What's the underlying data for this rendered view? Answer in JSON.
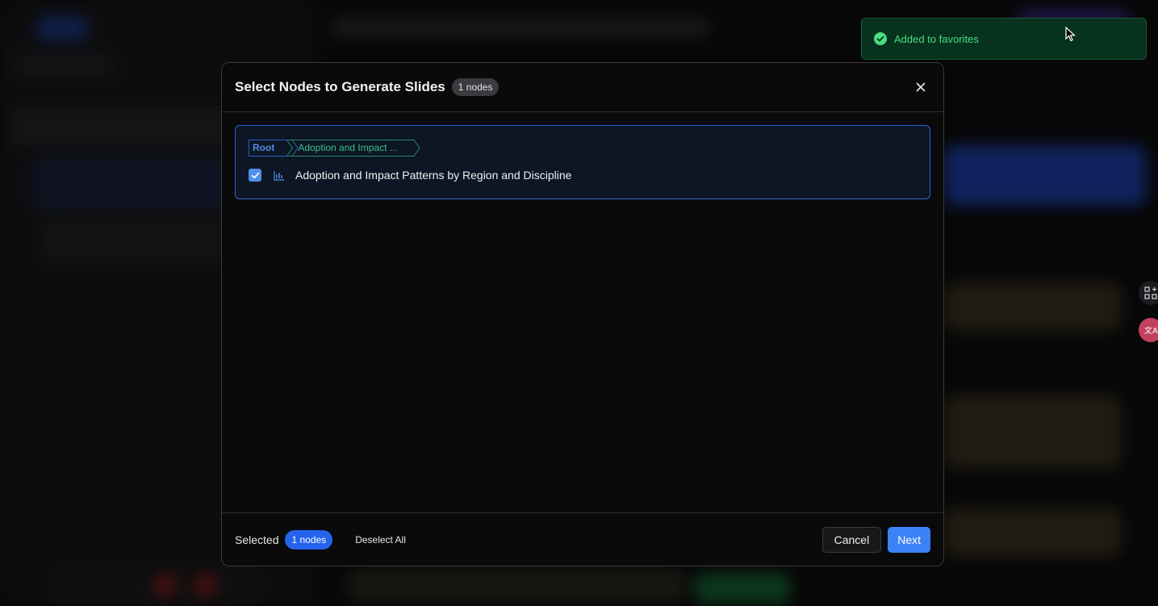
{
  "toast": {
    "message": "Added to favorites",
    "color": "#4ade80"
  },
  "modal": {
    "title": "Select Nodes to Generate Slides",
    "count_badge": "1 nodes",
    "breadcrumb": {
      "root": "Root",
      "child": "Adoption and Impact ..."
    },
    "node": {
      "label": "Adoption and Impact Patterns by Region and Discipline",
      "checked": true
    },
    "footer": {
      "selected_label": "Selected",
      "selected_count": "1 nodes",
      "deselect_all": "Deselect All",
      "cancel": "Cancel",
      "next": "Next"
    }
  },
  "edge_icons": [
    "apps-add-icon",
    "translate-icon"
  ],
  "colors": {
    "accent": "#3b82f6",
    "card_border": "#2a63d4",
    "crumb_child": "#3fbf8a"
  }
}
